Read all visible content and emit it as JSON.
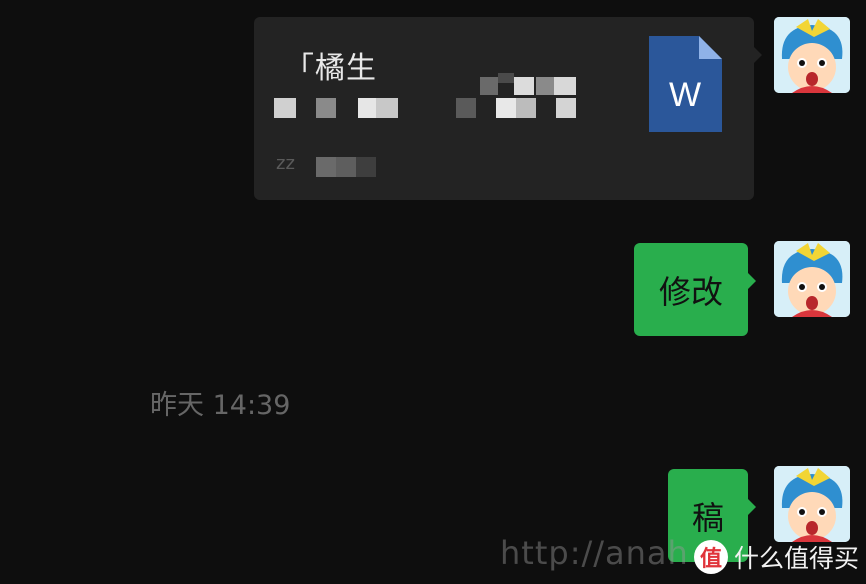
{
  "messages": {
    "file_card": {
      "title": "「橘生",
      "size_prefix": "zz",
      "file_icon_letter": "W",
      "file_icon_name": "word-document-icon"
    },
    "bubble_1": {
      "text": "修改"
    },
    "timestamp": "昨天 14:39",
    "bubble_2": {
      "text": "稿"
    }
  },
  "avatar": {
    "icon_name": "crayon-shin-chan-avatar-icon"
  },
  "watermark": {
    "url_text": "http://anah",
    "brand_text": "什么值得买",
    "brand_logo_text": "值"
  },
  "colors": {
    "background": "#0e0e0e",
    "file_card_bg": "#232323",
    "bubble_green": "#29ae4d",
    "word_blue": "#2b579a",
    "timestamp_gray": "#666666"
  }
}
